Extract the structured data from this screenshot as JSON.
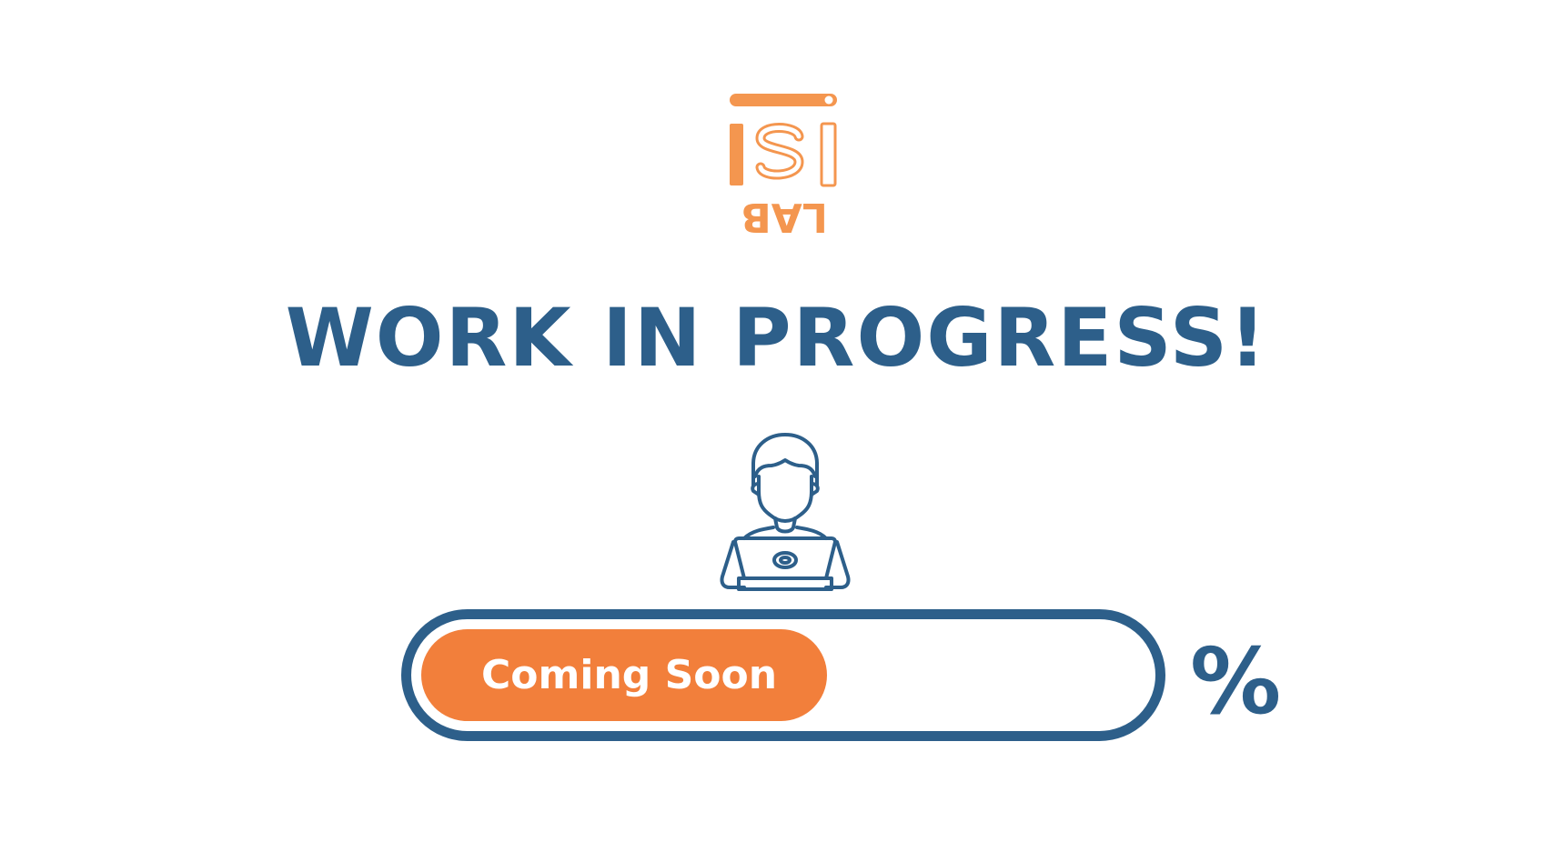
{
  "logo": {
    "text": "ISI LAB",
    "color": "#f4964f"
  },
  "headline": "WORK IN PROGRESS!",
  "illustration": {
    "icon": "person-at-laptop-icon",
    "color": "#2d5f8a"
  },
  "progress": {
    "label": "Coming Soon",
    "value_fraction": 0.56,
    "percent_sign": "%",
    "fill_color": "#f27f3b",
    "track_color": "#2d5f8a"
  }
}
